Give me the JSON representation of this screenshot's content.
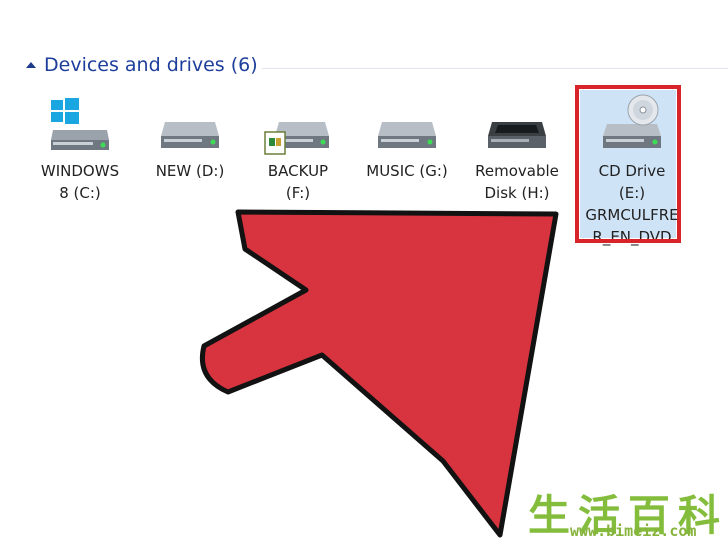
{
  "section": {
    "title": "Devices and drives (6)"
  },
  "drives": [
    {
      "id": "c",
      "line1": "WINDOWS",
      "line2": "8 (C:)",
      "icon": "windows-drive-icon"
    },
    {
      "id": "d",
      "line1": "NEW (D:)",
      "line2": "",
      "icon": "hard-drive-icon"
    },
    {
      "id": "f",
      "line1": "BACKUP",
      "line2": "(F:)",
      "icon": "backup-drive-icon"
    },
    {
      "id": "g",
      "line1": "MUSIC (G:)",
      "line2": "",
      "icon": "hard-drive-icon"
    },
    {
      "id": "h",
      "line1": "Removable",
      "line2": "Disk (H:)",
      "icon": "removable-drive-icon"
    },
    {
      "id": "e",
      "line1": "CD Drive",
      "line2": "(E:)",
      "line3": "GRMCULFRE",
      "line4": "R_EN_DVD",
      "icon": "cd-drive-icon"
    }
  ],
  "watermark": {
    "chinese": "生活百科",
    "url": "www.bimeiz.com"
  },
  "colors": {
    "highlight": "#d8232a",
    "arrow": "#d8343f",
    "title": "#1e3e9c",
    "watermark": "#84bd3c"
  }
}
